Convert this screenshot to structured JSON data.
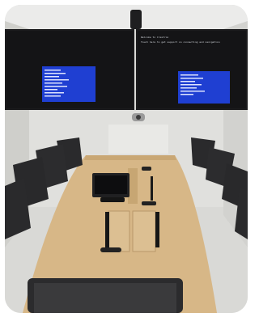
{
  "photo": {
    "subject": "",
    "colors": {
      "wall": "#e6e6e3",
      "table": "#d8b98a",
      "chair": "#2a2a2c",
      "tv_frame": "#1c1c1e",
      "tv_screen_blue": "#1f3fd2"
    },
    "screens": {
      "left_tv_text": "",
      "right_tv_text": "",
      "right_display_lines": [
        "Welcome to Crestron",
        "Touch here to get support on connecting and navigation"
      ]
    }
  }
}
